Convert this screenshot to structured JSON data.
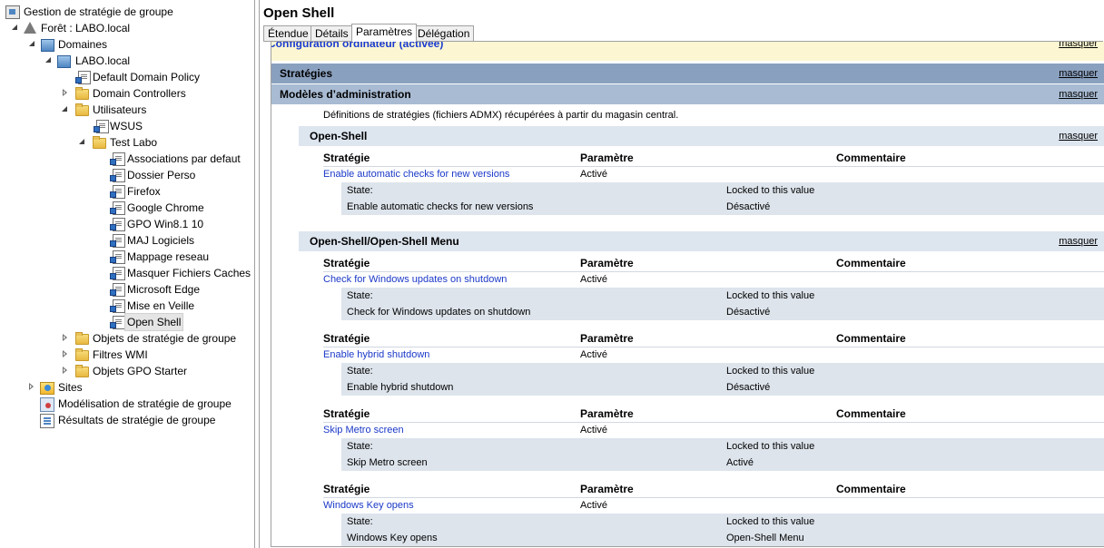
{
  "tree": {
    "root": "Gestion de stratégie de groupe",
    "forest": "Forêt : LABO.local",
    "domains": "Domaines",
    "domain": "LABO.local",
    "default_policy": "Default Domain Policy",
    "domain_controllers": "Domain Controllers",
    "utilisateurs": "Utilisateurs",
    "wsus": "WSUS",
    "test_labo": "Test Labo",
    "gpos": [
      "Associations par defaut",
      "Dossier Perso",
      "Firefox",
      "Google Chrome",
      "GPO Win8.1 10",
      "MAJ Logiciels",
      "Mappage reseau",
      "Masquer Fichiers Caches",
      "Microsoft Edge",
      "Mise en Veille",
      "Open Shell"
    ],
    "gpo_objects": "Objets de stratégie de groupe",
    "wmi": "Filtres WMI",
    "starter": "Objets GPO Starter",
    "sites": "Sites",
    "modeling": "Modélisation de stratégie de groupe",
    "results": "Résultats de stratégie de groupe"
  },
  "pane": {
    "title": "Open Shell",
    "tabs": [
      "Étendue",
      "Détails",
      "Paramètres",
      "Délégation"
    ],
    "active_tab": "Paramètres",
    "hide_label": "masquer",
    "config": "Configuration ordinateur (activée)",
    "strategies": "Stratégies",
    "admx_header": "Modèles d’administration",
    "admx_note": "Définitions de stratégies (fichiers ADMX) récupérées à partir du magasin central.",
    "col_policy": "Stratégie",
    "col_setting": "Paramètre",
    "col_comment": "Commentaire",
    "state_label": "State:",
    "state_value": "Locked to this value",
    "sections": [
      {
        "name": "Open-Shell",
        "policies": [
          {
            "name": "Enable automatic checks for new versions",
            "setting": "Activé",
            "sub_label": "Enable automatic checks for new versions",
            "sub_value": "Désactivé"
          }
        ]
      },
      {
        "name": "Open-Shell/Open-Shell Menu",
        "policies": [
          {
            "name": "Check for Windows updates on shutdown",
            "setting": "Activé",
            "sub_label": "Check for Windows updates on shutdown",
            "sub_value": "Désactivé"
          },
          {
            "name": "Enable hybrid shutdown",
            "setting": "Activé",
            "sub_label": "Enable hybrid shutdown",
            "sub_value": "Désactivé"
          },
          {
            "name": "Skip Metro screen",
            "setting": "Activé",
            "sub_label": "Skip Metro screen",
            "sub_value": "Activé"
          },
          {
            "name": "Windows Key opens",
            "setting": "Activé",
            "sub_label": "Windows Key opens",
            "sub_value": "Open-Shell Menu"
          }
        ]
      }
    ]
  }
}
